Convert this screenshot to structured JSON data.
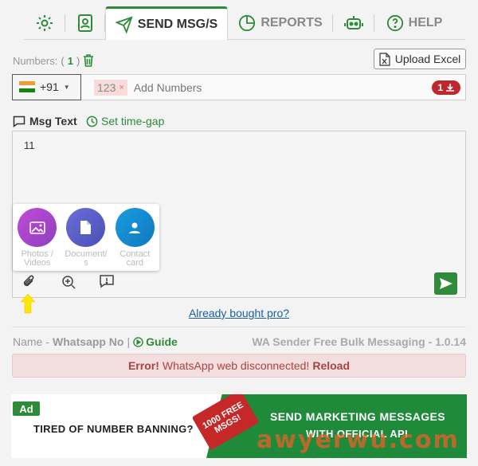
{
  "nav": {
    "send_label": "SEND MSG/S",
    "reports_label": "REPORTS",
    "help_label": "HELP"
  },
  "numbers": {
    "label": "Numbers:",
    "open": "(",
    "count": "1",
    "close": ")",
    "upload_label": "Upload Excel"
  },
  "phone_input": {
    "country_code": "+91",
    "chip_value": "123",
    "chip_remove": "×",
    "placeholder": "Add Numbers",
    "badge_count": "1"
  },
  "message": {
    "label": "Msg Text",
    "timegap_label": "Set time-gap",
    "text": "11"
  },
  "attach": {
    "photos_label": "Photos / Videos",
    "document_label": "Document/ s",
    "contact_label": "Contact card"
  },
  "bought_link": "Already bought pro?",
  "footer": {
    "name": "Name",
    "dash": "-",
    "whatsapp_no": "Whatsapp No",
    "pipe": "|",
    "guide": "Guide",
    "version": "WA Sender Free Bulk Messaging - 1.0.14"
  },
  "error": {
    "prefix": "Error!",
    "message": "WhatsApp web disconnected!",
    "reload": "Reload"
  },
  "ad": {
    "tag": "Ad",
    "left_text": "TIRED OF NUMBER BANNING?",
    "ribbon_line1": "1000 FREE",
    "ribbon_line2": "MSGS!",
    "right_line1": "SEND  MARKETING MESSAGES",
    "right_line2": "WITH OFFICIAL API"
  },
  "watermark": "awyerwu.com",
  "colors": {
    "accent_green": "#2e8b3a",
    "error_red": "#a94442",
    "badge_red": "#c0272d"
  }
}
